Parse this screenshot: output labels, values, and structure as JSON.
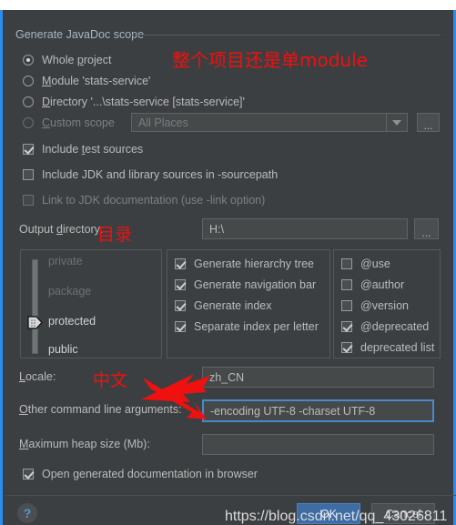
{
  "dialog": {
    "group_title": "Generate JavaDoc scope",
    "accent_blue": "#2d8cf0",
    "background": "#3c3f41"
  },
  "scope": {
    "options": [
      {
        "label": "Whole project",
        "mnemonic": "p",
        "selected": true,
        "enabled": true
      },
      {
        "label": "Module 'stats-service'",
        "mnemonic": "M",
        "selected": false,
        "enabled": true
      },
      {
        "label": "Directory '...\\stats-service [stats-service]'",
        "mnemonic": "D",
        "selected": false,
        "enabled": true
      },
      {
        "label": "Custom scope",
        "mnemonic": "C",
        "selected": false,
        "enabled": false
      }
    ],
    "custom_scope_combo": {
      "value": "All Places",
      "placeholder": "All Places",
      "browse_label": "..."
    }
  },
  "source_options": [
    {
      "label": "Include test sources",
      "checked": true,
      "enabled": true
    },
    {
      "label": "Include JDK and library sources in -sourcepath",
      "checked": false,
      "enabled": true
    },
    {
      "label": "Link to JDK documentation (use -link option)",
      "checked": false,
      "enabled": false
    }
  ],
  "output": {
    "label": "Output directory:",
    "value": "H:\\",
    "placeholder": "",
    "browse_label": "..."
  },
  "visibility_slider": {
    "levels": [
      "private",
      "package",
      "protected",
      "public"
    ],
    "selected": "protected",
    "enabled_from_index": 2
  },
  "generate_options": [
    {
      "label": "Generate hierarchy tree",
      "checked": true
    },
    {
      "label": "Generate navigation bar",
      "checked": true
    },
    {
      "label": "Generate index",
      "checked": true
    },
    {
      "label": "Separate index per letter",
      "checked": true
    }
  ],
  "tag_options": [
    {
      "label": "@use",
      "checked": false
    },
    {
      "label": "@author",
      "checked": false
    },
    {
      "label": "@version",
      "checked": false
    },
    {
      "label": "@deprecated",
      "checked": true
    },
    {
      "label": "deprecated list",
      "checked": true
    }
  ],
  "fields": {
    "locale": {
      "label": "Locale:",
      "mnemonic": "L",
      "value": "zh_CN",
      "placeholder": ""
    },
    "other_args": {
      "label": "Other command line arguments:",
      "mnemonic": "O",
      "value": "-encoding UTF-8 -charset UTF-8",
      "placeholder": "",
      "focused": true
    },
    "heap": {
      "label": "Maximum heap size (Mb):",
      "mnemonic": "M",
      "value": "",
      "placeholder": ""
    }
  },
  "open_browser": {
    "label": "Open generated documentation in browser",
    "checked": true
  },
  "footer": {
    "help_label": "?",
    "ok_label": "OK",
    "cancel_label": "Cancel"
  },
  "annotations": {
    "scope_note": "整个项目还是单module",
    "output_note": "目录",
    "locale_note": "中文",
    "color": "#ef1010"
  },
  "watermark": {
    "text": "https://blog.csdn.net/qq_43026811"
  }
}
